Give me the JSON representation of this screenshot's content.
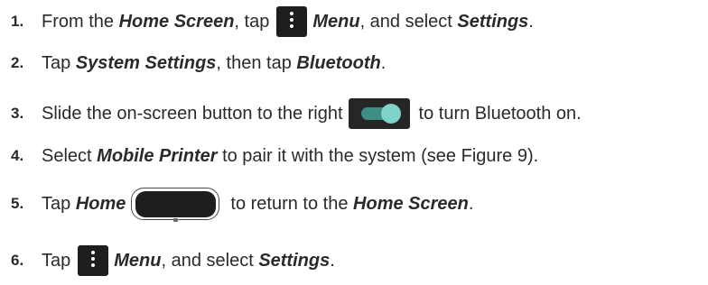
{
  "steps": [
    {
      "number": "1.",
      "t1": "From the ",
      "b1": "Home Screen",
      "t2": ", tap",
      "icon": "vertical-ellipsis-menu-icon",
      "b2": "Menu",
      "t3": ", and select ",
      "b3": "Settings",
      "t4": "."
    },
    {
      "number": "2.",
      "t1": "Tap ",
      "b1": "System Settings",
      "t2": ", then tap ",
      "b2": "Bluetooth",
      "t3": "."
    },
    {
      "number": "3.",
      "t1": "Slide the on-screen button to the right",
      "icon": "toggle-switch-on-icon",
      "t2": "to turn Bluetooth on."
    },
    {
      "number": "4.",
      "t1": "Select ",
      "b1": "Mobile Printer",
      "t2": " to pair it with the system (see Figure 9)."
    },
    {
      "number": "5.",
      "t1": "Tap ",
      "b1": "Home",
      "icon": "home-button-icon",
      "t2": "to return to the ",
      "b2": "Home Screen",
      "t3": "."
    },
    {
      "number": "6.",
      "t1": "Tap",
      "icon": "vertical-ellipsis-menu-icon",
      "b1": "Menu",
      "t2": ", and select ",
      "b2": "Settings",
      "t3": "."
    }
  ],
  "colors": {
    "text": "#2a2a2a",
    "icon_dark": "#1e1e1e",
    "toggle_track": "#3e8e87",
    "toggle_knob": "#7fd3cb"
  }
}
